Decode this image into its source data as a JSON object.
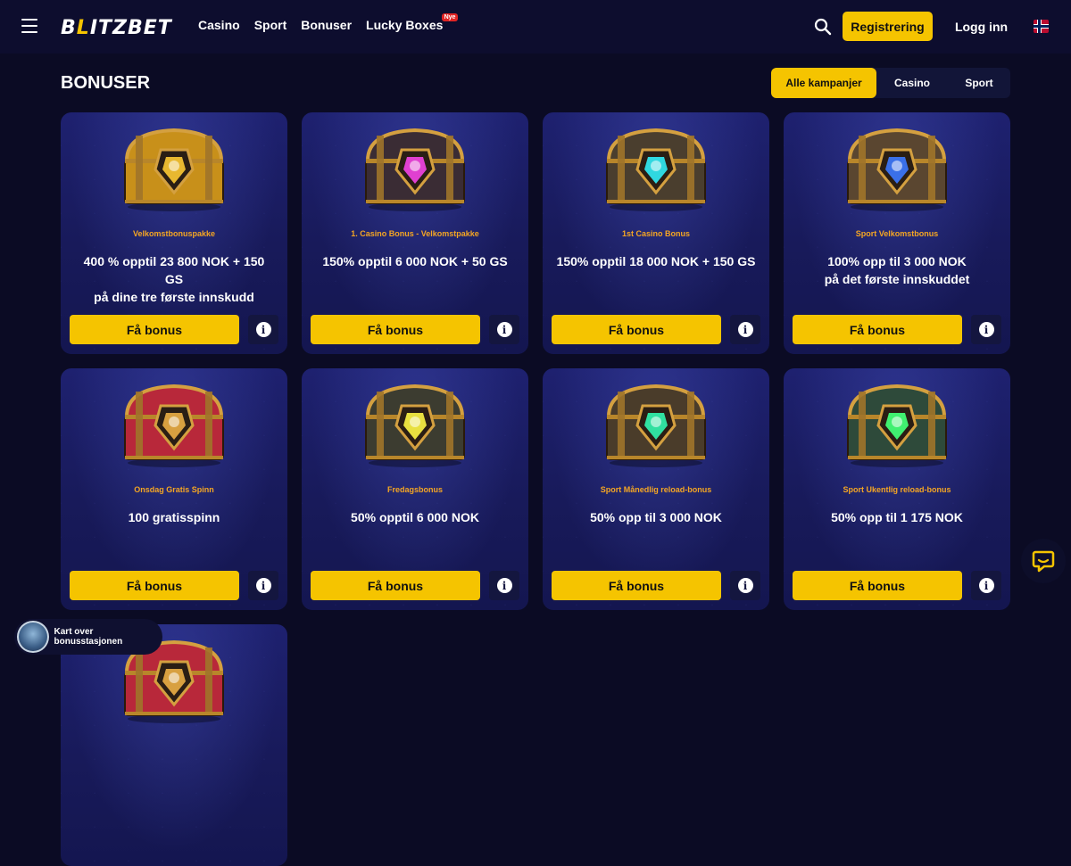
{
  "header": {
    "logo": "BLITZBET",
    "nav": [
      {
        "label": "Casino"
      },
      {
        "label": "Sport"
      },
      {
        "label": "Bonuser"
      },
      {
        "label": "Lucky Boxes",
        "badge": "Nye"
      }
    ],
    "register_label": "Registrering",
    "login_label": "Logg inn",
    "language_flag": "norway-flag-icon"
  },
  "page": {
    "title": "BONUSER",
    "filters": [
      {
        "label": "Alle kampanjer",
        "active": true
      },
      {
        "label": "Casino",
        "active": false
      },
      {
        "label": "Sport",
        "active": false
      }
    ]
  },
  "cards": [
    {
      "subtitle": "Velkomstbonuspakke",
      "title_line1": "400 % opptil 23 800 NOK + 150 GS",
      "title_line2": "på dine tre første innskudd",
      "button": "Få bonus",
      "chest_color": "#c8901a",
      "chest_accent": "#e8b830"
    },
    {
      "subtitle": "1. Casino Bonus - Velkomstpakke",
      "title_line1": "150% opptil 6 000 NOK + 50 GS",
      "title_line2": "",
      "button": "Få bonus",
      "chest_color": "#3a2c34",
      "chest_accent": "#e040d0"
    },
    {
      "subtitle": "1st Casino Bonus",
      "title_line1": "150% opptil 18 000 NOK + 150 GS",
      "title_line2": "",
      "button": "Få bonus",
      "chest_color": "#4a3e2e",
      "chest_accent": "#30d8e0"
    },
    {
      "subtitle": "Sport Velkomstbonus",
      "title_line1": "100% opp til 3 000 NOK",
      "title_line2": "på det første innskuddet",
      "button": "Få bonus",
      "chest_color": "#5a4630",
      "chest_accent": "#3a70e8"
    },
    {
      "subtitle": "Onsdag Gratis Spinn",
      "title_line1": "100 gratisspinn",
      "title_line2": "",
      "button": "Få bonus",
      "chest_color": "#b8283a",
      "chest_accent": "#d8a040"
    },
    {
      "subtitle": "Fredagsbonus",
      "title_line1": "50% opptil 6 000 NOK",
      "title_line2": "",
      "button": "Få bonus",
      "chest_color": "#3c3c30",
      "chest_accent": "#e8e040"
    },
    {
      "subtitle": "Sport Månedlig reload-bonus",
      "title_line1": "50% opp til 3 000 NOK",
      "title_line2": "",
      "button": "Få bonus",
      "chest_color": "#4a3c2a",
      "chest_accent": "#30e0a0"
    },
    {
      "subtitle": "Sport Ukentlig reload-bonus",
      "title_line1": "50% opp til 1 175 NOK",
      "title_line2": "",
      "button": "Få bonus",
      "chest_color": "#2e4a3a",
      "chest_accent": "#40f070"
    },
    {
      "subtitle": "",
      "title_line1": "",
      "title_line2": "",
      "button": "",
      "chest_color": "#b8283a",
      "chest_accent": "#d8a040"
    }
  ],
  "widgets": {
    "map_label": "Kart over bonusstasjonen",
    "chat_icon": "chat-icon"
  }
}
